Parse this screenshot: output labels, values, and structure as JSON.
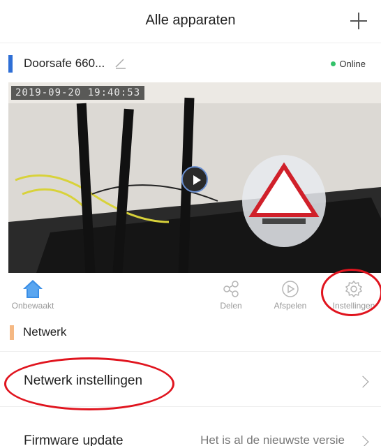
{
  "header": {
    "title": "Alle apparaten",
    "add_icon": "plus-icon"
  },
  "device": {
    "name": "Doorsafe 660...",
    "edit_icon": "pencil-icon",
    "status": "Online",
    "status_color": "#33c26a",
    "accent_color": "#2f6fd6"
  },
  "video": {
    "timestamp": "2019-09-20  19:40:53",
    "play_icon": "play-icon"
  },
  "actions": [
    {
      "label": "Onbewaakt",
      "icon": "home-shield-icon"
    },
    {
      "label": "Delen",
      "icon": "share-icon"
    },
    {
      "label": "Afspelen",
      "icon": "playback-icon"
    },
    {
      "label": "Instellingen",
      "icon": "gear-icon"
    }
  ],
  "section": {
    "title": "Netwerk",
    "accent_color": "#f5b883"
  },
  "rows": [
    {
      "label": "Netwerk instellingen",
      "value": ""
    },
    {
      "label": "Firmware update",
      "value": "Het is al de nieuwste versie"
    }
  ],
  "highlight_color": "#e0141e"
}
